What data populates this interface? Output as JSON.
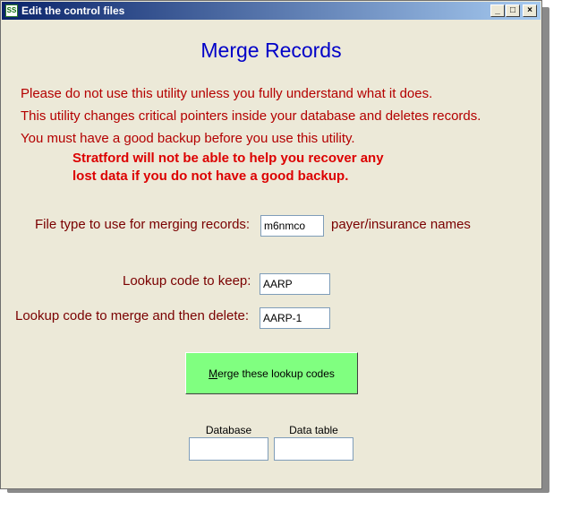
{
  "window": {
    "title": "Edit the control files",
    "app_icon": "SS",
    "buttons": {
      "minimize": "_",
      "maximize": "□",
      "close": "×"
    }
  },
  "heading": "Merge Records",
  "warnings": [
    "Please do not use this utility unless you fully understand what it does.",
    "This utility changes critical pointers inside your database and deletes records.",
    "You must have a good backup before you use this utility."
  ],
  "bold_warning": [
    "Stratford will not be able to help you recover any",
    "lost data if you do not have a good backup."
  ],
  "file_type": {
    "label": "File type to use for merging records:",
    "value": "m6nmco",
    "suffix": "payer/insurance names"
  },
  "keep": {
    "label": "Lookup code to keep:",
    "value": "AARP"
  },
  "merge_delete": {
    "label": "Lookup code to merge and then delete:",
    "value": "AARP-1"
  },
  "merge_button": {
    "mnemonic": "M",
    "rest": "erge these lookup codes"
  },
  "database": {
    "label": "Database",
    "value": ""
  },
  "data_table": {
    "label": "Data table",
    "value": ""
  },
  "colors": {
    "button_green": "#80ff80",
    "heading_blue": "#0000c8",
    "warning_red": "#b40000"
  }
}
